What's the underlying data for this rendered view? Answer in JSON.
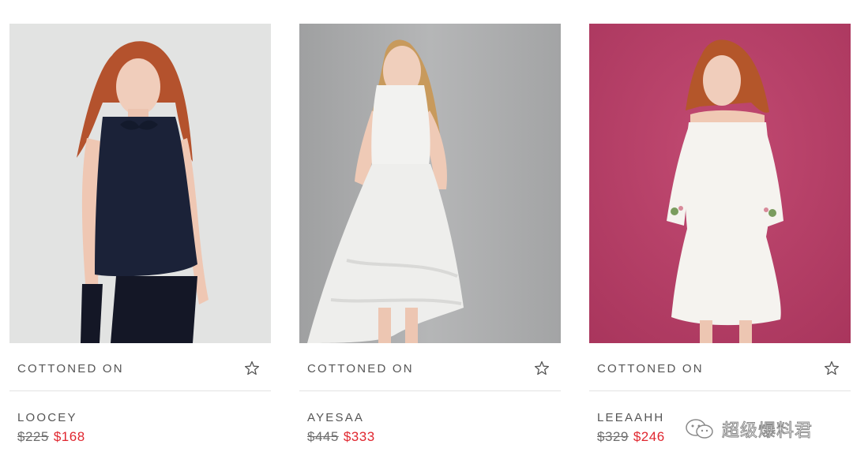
{
  "products": [
    {
      "brand": "COTTONED ON",
      "name": "LOOCEY",
      "old_price": "$225",
      "new_price": "$168",
      "background_color": "#e2e3e2",
      "garment_color": "#1b2238"
    },
    {
      "brand": "COTTONED ON",
      "name": "AYESAA",
      "old_price": "$445",
      "new_price": "$333",
      "background_color": "#a9aaab",
      "garment_color": "#f2f2f0"
    },
    {
      "brand": "COTTONED ON",
      "name": "LEEAAHH",
      "old_price": "$329",
      "new_price": "$246",
      "background_color": "#b83f68",
      "garment_color": "#f5f3ef"
    }
  ],
  "icons": {
    "favorite": "star-outline-icon",
    "watermark": "wechat-icon"
  },
  "colors": {
    "sale_price": "#e0262f",
    "old_price": "#6d6d6d",
    "divider": "#e2e2e2"
  },
  "watermark": {
    "text": "超级爆料君"
  }
}
